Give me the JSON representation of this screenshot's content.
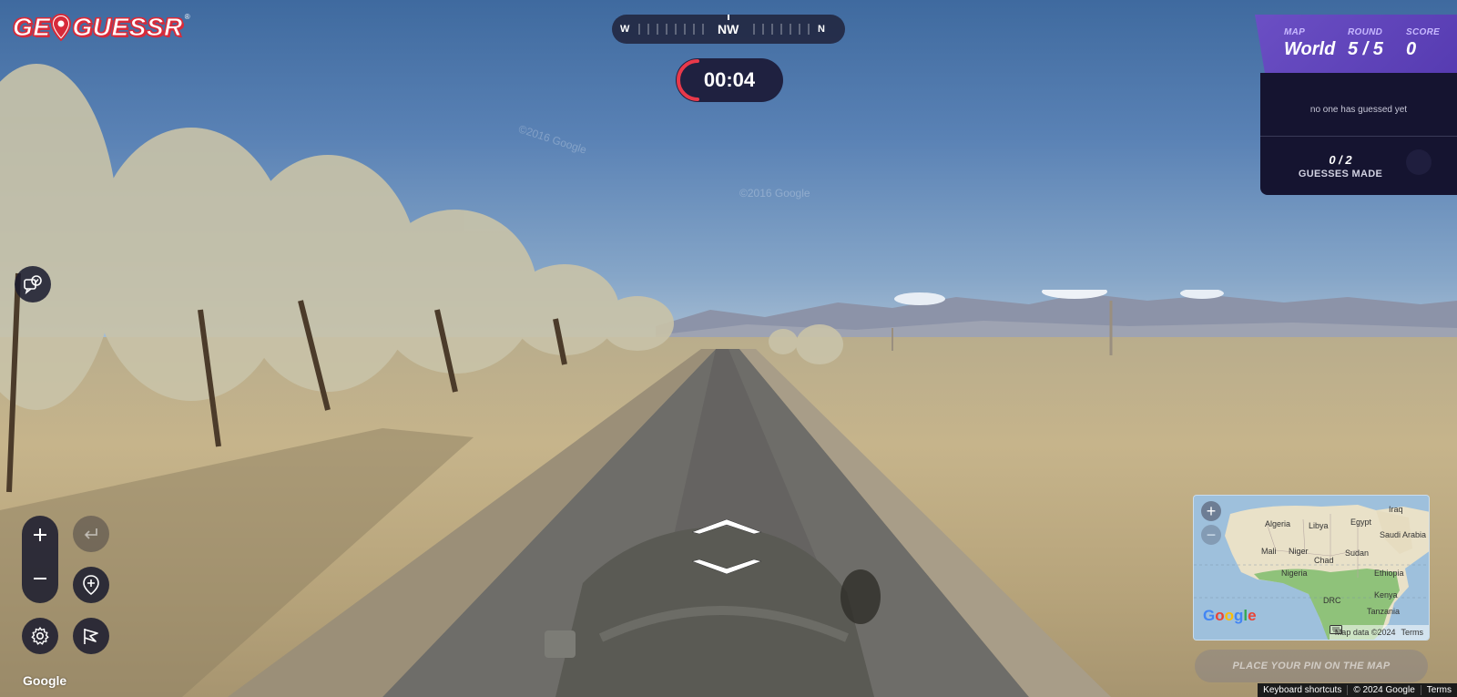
{
  "logo": {
    "text_left": "GE",
    "text_right": "GUESSR",
    "registered": "®"
  },
  "compass": {
    "left": "W",
    "center": "NW",
    "right": "N"
  },
  "timer": {
    "value": "00:04",
    "remaining_fraction": 0.15
  },
  "status": {
    "map_label": "MAP",
    "map_value": "World",
    "round_label": "ROUND",
    "round_value": "5 / 5",
    "score_label": "SCORE",
    "score_value": "0"
  },
  "guesses": {
    "message": "no one has guessed yet",
    "count": "0 / 2",
    "label": "GUESSES MADE"
  },
  "scene": {
    "watermark1": "©2016 Google",
    "watermark2": "©2016 Google"
  },
  "minimap": {
    "labels": [
      "Algeria",
      "Libya",
      "Egypt",
      "Iraq",
      "Saudi Arabia",
      "Mali",
      "Niger",
      "Chad",
      "Sudan",
      "Nigeria",
      "Ethiopia",
      "DRC",
      "Kenya",
      "Tanzania"
    ],
    "google": "Google",
    "map_data": "Map data ©2024",
    "terms": "Terms",
    "zoom_in": "+",
    "zoom_out": "−"
  },
  "place_pin": "PLACE YOUR PIN ON THE MAP",
  "google_logo": "Google",
  "footer": {
    "shortcuts": "Keyboard shortcuts",
    "copyright": "© 2024 Google",
    "terms": "Terms"
  },
  "colors": {
    "accent_red": "#d72b3a",
    "status_purple": "#6b4fc4",
    "panel_dark": "#151430"
  },
  "icons": [
    "chat-icon",
    "zoom-in-icon",
    "zoom-out-icon",
    "undo-icon",
    "add-pin-icon",
    "settings-icon",
    "flag-icon",
    "arrow-up-icon",
    "arrow-down-icon",
    "keyboard-icon"
  ]
}
